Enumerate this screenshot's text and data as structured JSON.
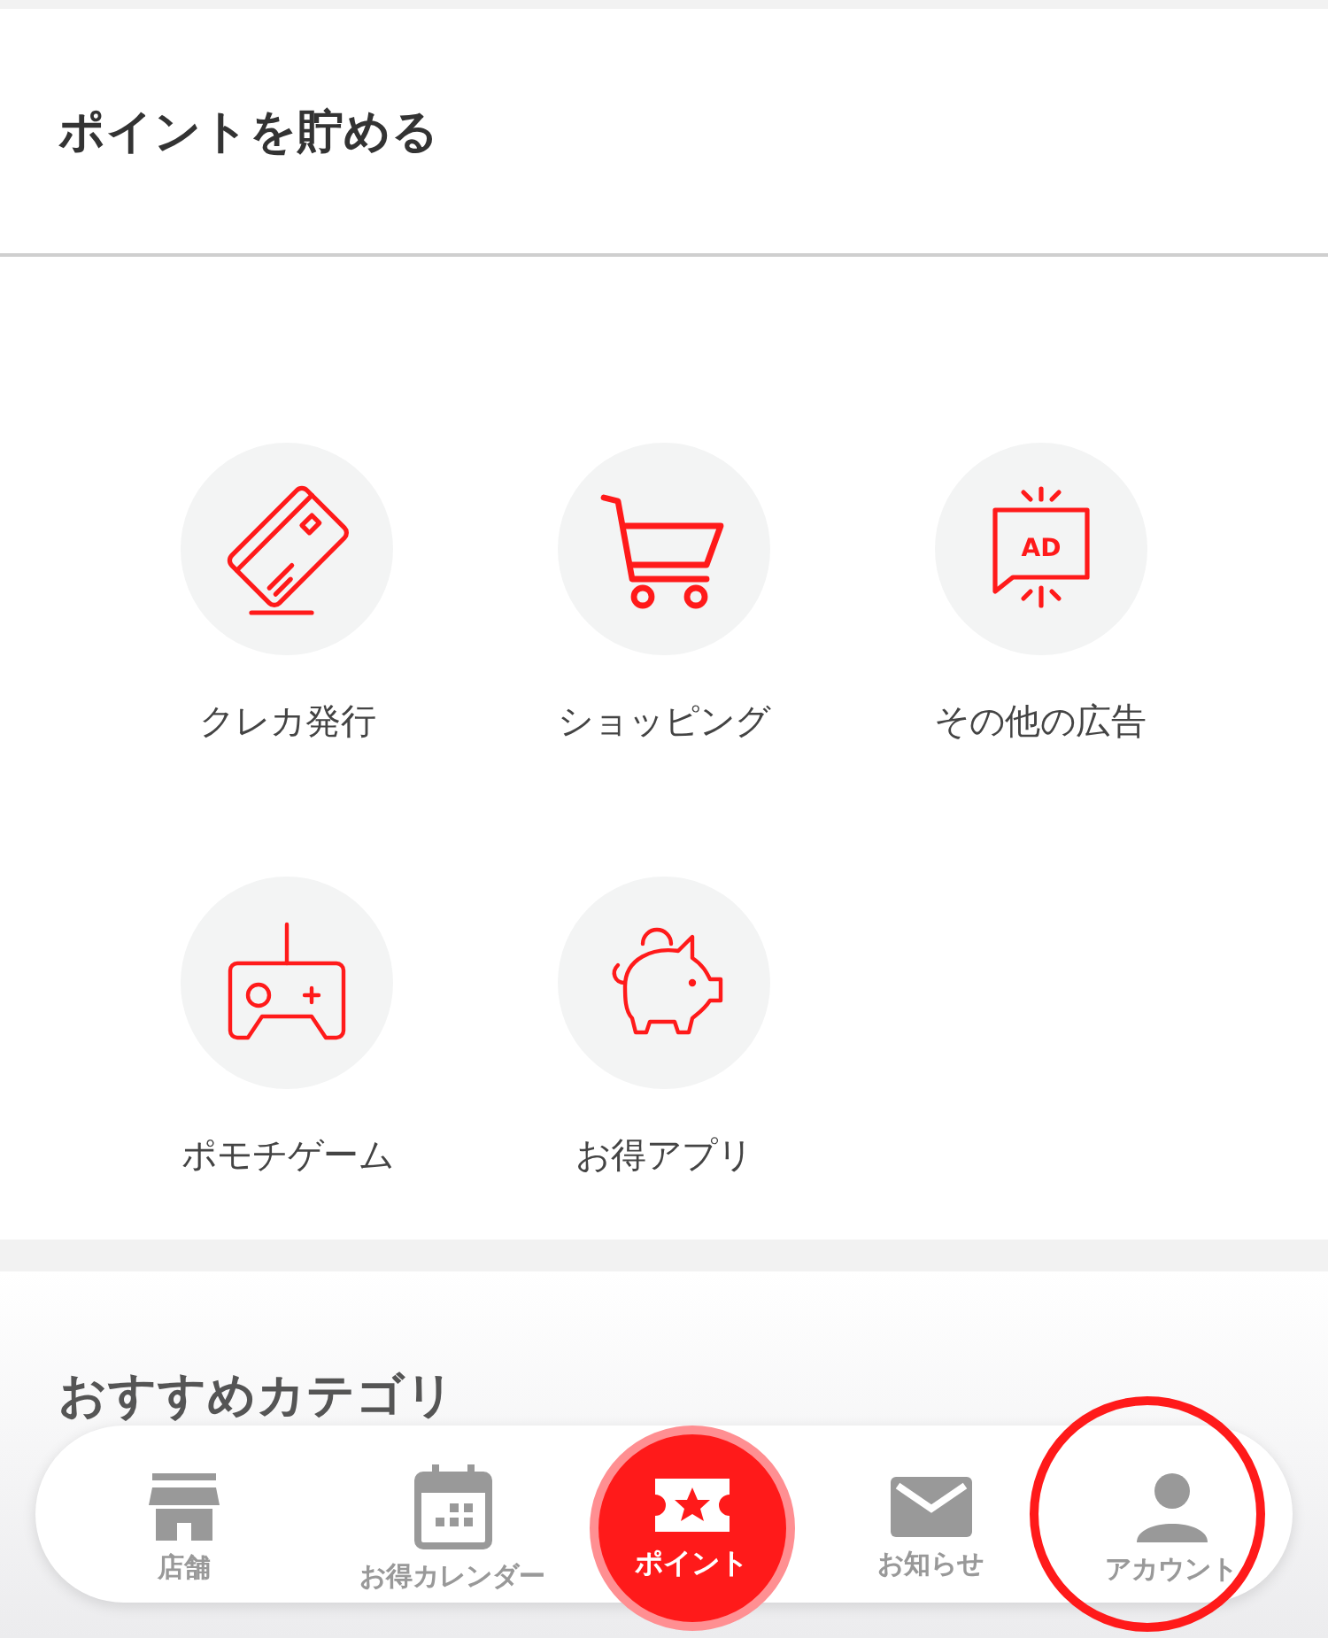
{
  "header": {
    "title": "ポイントを貯める"
  },
  "services": [
    {
      "kind": "card",
      "label": "クレカ発行"
    },
    {
      "kind": "cart",
      "label": "ショッピング"
    },
    {
      "kind": "ad",
      "label": "その他の広告",
      "icon_text": "AD"
    },
    {
      "kind": "gamepad",
      "label": "ポモチゲーム"
    },
    {
      "kind": "piggy",
      "label": "お得アプリ"
    }
  ],
  "recommended": {
    "title": "おすすめカテゴリ"
  },
  "tab_bar": [
    {
      "kind": "store",
      "label": "店舗",
      "selected": false,
      "highlighted": false
    },
    {
      "kind": "calendar",
      "label": "お得カレンダー",
      "selected": false,
      "highlighted": false
    },
    {
      "kind": "ticket",
      "label": "ポイント",
      "selected": true,
      "highlighted": false
    },
    {
      "kind": "mail",
      "label": "お知らせ",
      "selected": false,
      "highlighted": false
    },
    {
      "kind": "person",
      "label": "アカウント",
      "selected": false,
      "highlighted": true
    }
  ]
}
